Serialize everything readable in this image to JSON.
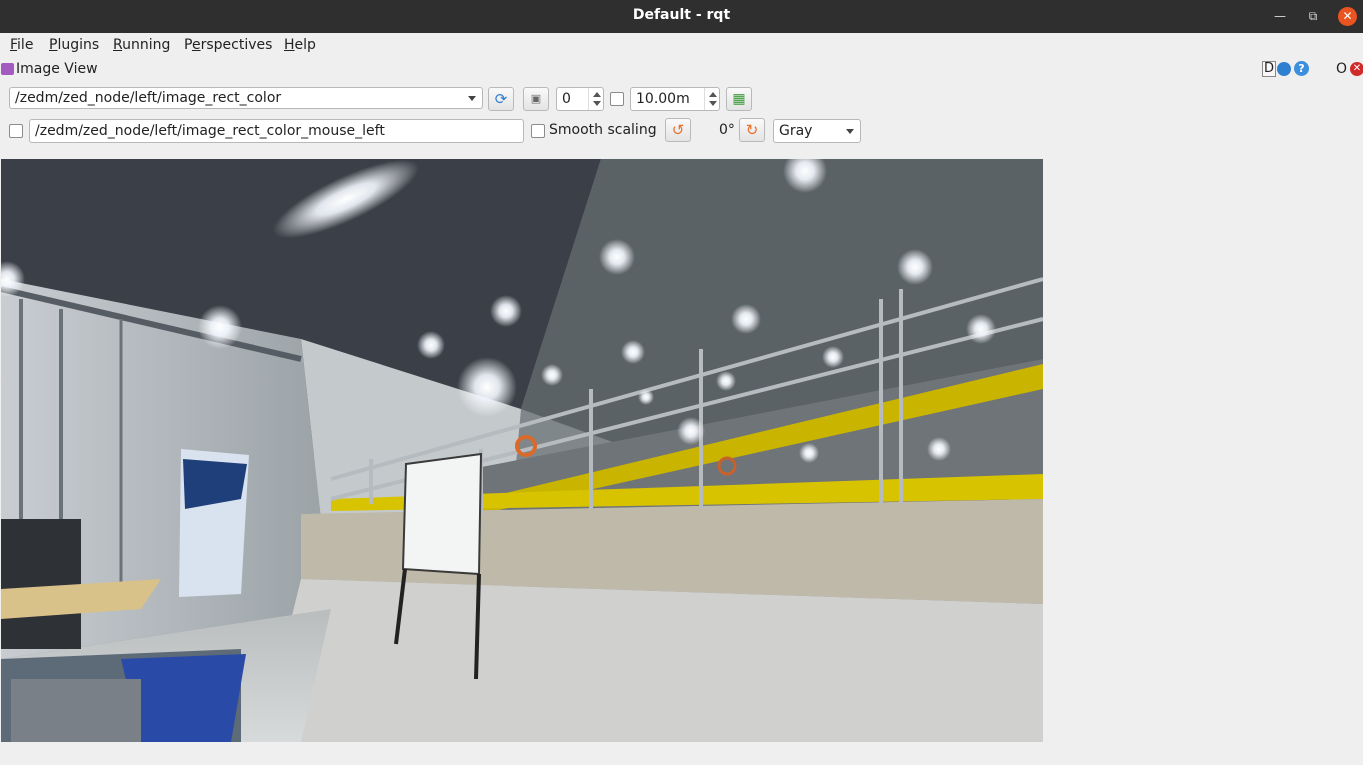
{
  "window": {
    "title": "Default - rqt",
    "minimize_icon": "minimize-icon",
    "maximize_icon": "maximize-icon",
    "close_icon": "close-icon"
  },
  "menu": [
    {
      "label": "File",
      "mnemonic": "F"
    },
    {
      "label": "Plugins",
      "mnemonic": "P"
    },
    {
      "label": "Running",
      "mnemonic": "R"
    },
    {
      "label": "Perspectives",
      "mnemonic": "e"
    },
    {
      "label": "Help",
      "mnemonic": "H"
    }
  ],
  "plugin": {
    "title": "Image View",
    "tools": {
      "d": "D",
      "o": "O"
    }
  },
  "toolbar": {
    "topic": "/zedm/zed_node/left/image_rect_color",
    "spin_value": "0",
    "distance": "10.00m",
    "mouse_topic": "/zedm/zed_node/left/image_rect_color_mouse_left",
    "smooth_scaling_label": "Smooth scaling",
    "rotation_label": "0°",
    "colormap": "Gray",
    "checkboxes": {
      "spin_check": false,
      "mouse_publish": false,
      "smooth_scaling": false
    }
  },
  "colors": {
    "titlebar": "#2f2f2f",
    "close": "#e95420",
    "accent_blue": "#2f7fd1",
    "orange": "#e8702a"
  }
}
